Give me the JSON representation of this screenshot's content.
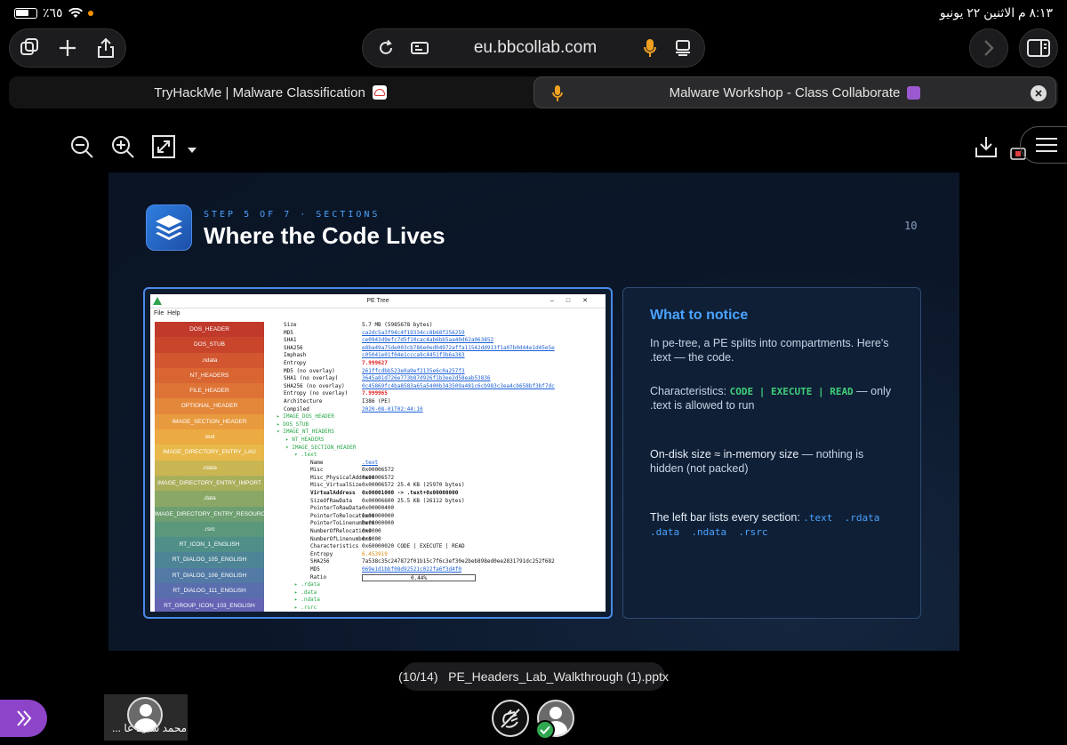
{
  "status_bar": {
    "battery": "٪٦٥",
    "time_date": "٨:١٣ م   الاثنين ٢٢ يونيو"
  },
  "browser": {
    "url": "eu.bbcollab.com",
    "tabs": [
      {
        "label": "TryHackMe | Malware Classification",
        "active": false
      },
      {
        "label": "Malware Workshop - Class Collaborate",
        "active": true
      }
    ]
  },
  "slide": {
    "step": "STEP 5 OF 7 · SECTIONS",
    "title": "Where the Code Lives",
    "page_number": "10",
    "pe_window": {
      "title": "PE Tree",
      "menu": [
        "File",
        "Help"
      ],
      "sections": [
        {
          "label": "DOS_HEADER",
          "color": "#c0392b"
        },
        {
          "label": "DOS_STUB",
          "color": "#c8452b"
        },
        {
          "label": ".ndata",
          "color": "#d2562f"
        },
        {
          "label": "NT_HEADERS",
          "color": "#d86532"
        },
        {
          "label": "FILE_HEADER",
          "color": "#de7336"
        },
        {
          "label": "OPTIONAL_HEADER",
          "color": "#e3873a"
        },
        {
          "label": "IMAGE_SECTION_HEADER",
          "color": "#e89a3e"
        },
        {
          "label": ".text",
          "color": "#ecaa42"
        },
        {
          "label": "IMAGE_DIRECTORY_ENTRY_LAU",
          "color": "#e8b94a"
        },
        {
          "label": ".rdata",
          "color": "#c9b552"
        },
        {
          "label": "IMAGE_DIRECTORY_ENTRY_IMPORT",
          "color": "#a9ae5b"
        },
        {
          "label": ".data",
          "color": "#8aa765"
        },
        {
          "label": "IMAGE_DIRECTORY_ENTRY_RESOURC",
          "color": "#6e9f70"
        },
        {
          "label": ".rsrc",
          "color": "#5a977b"
        },
        {
          "label": "RT_ICON_1_ENGLISH",
          "color": "#4f8f88"
        },
        {
          "label": "RT_DIALOG_105_ENGLISH",
          "color": "#4e8596"
        },
        {
          "label": "RT_DIALOG_106_ENGLISH",
          "color": "#527aa4"
        },
        {
          "label": "RT_DIALOG_111_ENGLISH",
          "color": "#5a6eae"
        },
        {
          "label": "RT_GROUP_ICON_103_ENGLISH",
          "color": "#6463b4"
        }
      ],
      "tree_rows": [
        {
          "k": "Size",
          "v": "5.7 MB (5985678 bytes)",
          "indent": 0,
          "style": "plain"
        },
        {
          "k": "MD5",
          "v": "ca2dc5a3f94c4f19334cc8b68f256259",
          "indent": 0,
          "style": "link"
        },
        {
          "k": "SHA1",
          "v": "ce0943d9efc7d5f10cac4ab6bb5aa40d62a063852",
          "indent": 0,
          "style": "link"
        },
        {
          "k": "SHA256",
          "v": "e8ba49a75de003cb786e0ed04972affa11542dd913f1a07b0d44e1d45e5e",
          "indent": 0,
          "style": "link"
        },
        {
          "k": "Imphash",
          "v": "c05041e01f04e1ccca9c4451f3b6a383",
          "indent": 0,
          "style": "link"
        },
        {
          "k": "Entropy",
          "v": "7.999627",
          "indent": 0,
          "style": "red"
        },
        {
          "k": "MD5 (no overlay)",
          "v": "261ffcdbb523e0a9ef2135e6c0a257f3",
          "indent": 0,
          "style": "link"
        },
        {
          "k": "SHA1 (no overlay)",
          "v": "3645a81d726e773b87d926f1b3ee2d58eab53836",
          "indent": 0,
          "style": "link"
        },
        {
          "k": "SHA256 (no overlay)",
          "v": "0c45869fc4ba8583a65a5400b343509a481c6cb983c3ea4cb658bf3bf7dc",
          "indent": 0,
          "style": "link"
        },
        {
          "k": "Entropy (no overlay)",
          "v": "7.999965",
          "indent": 0,
          "style": "red"
        },
        {
          "k": "Architecture",
          "v": "I386 (PE)",
          "indent": 0,
          "style": "plain"
        },
        {
          "k": "Compiled",
          "v": "2020-08-01T02:44:10",
          "indent": 0,
          "style": "link"
        },
        {
          "k": "▸ IMAGE_DOS_HEADER",
          "v": "",
          "indent": -8,
          "style": "green"
        },
        {
          "k": "▸ DOS_STUB",
          "v": "",
          "indent": -8,
          "style": "green"
        },
        {
          "k": "▾ IMAGE_NT_HEADERS",
          "v": "",
          "indent": -8,
          "style": "green"
        },
        {
          "k": "▸ NT_HEADERS",
          "v": "",
          "indent": 2,
          "style": "green"
        },
        {
          "k": "▾ IMAGE_SECTION_HEADER",
          "v": "",
          "indent": 2,
          "style": "green"
        },
        {
          "k": "▾ .text",
          "v": "",
          "indent": 12,
          "style": "green"
        },
        {
          "k": "Name",
          "v": ".text",
          "indent": 30,
          "style": "link"
        },
        {
          "k": "Misc",
          "v": "0x00006572",
          "indent": 30,
          "style": "plain"
        },
        {
          "k": "Misc_PhysicalAddress",
          "v": "0x00006572",
          "indent": 30,
          "style": "plain"
        },
        {
          "k": "Misc_VirtualSize",
          "v": "0x00006572 25.4 KB (25970 bytes)",
          "indent": 30,
          "style": "plain"
        },
        {
          "k": "VirtualAddress",
          "v": "0x00001000 -> .text+0x00000000",
          "indent": 30,
          "style": "bold"
        },
        {
          "k": "SizeOfRawData",
          "v": "0x00006600 25.5 KB (26112 bytes)",
          "indent": 30,
          "style": "plain"
        },
        {
          "k": "PointerToRawData",
          "v": "0x00000400",
          "indent": 30,
          "style": "plain"
        },
        {
          "k": "PointerToRelocations",
          "v": "0x00000000",
          "indent": 30,
          "style": "plain"
        },
        {
          "k": "PointerToLinenumbers",
          "v": "0x00000000",
          "indent": 30,
          "style": "plain"
        },
        {
          "k": "NumberOfRelocations",
          "v": "0x0000",
          "indent": 30,
          "style": "plain"
        },
        {
          "k": "NumberOfLinenumbers",
          "v": "0x0000",
          "indent": 30,
          "style": "plain"
        },
        {
          "k": "Characteristics",
          "v": "0x60000020 CODE | EXECUTE | READ",
          "indent": 30,
          "style": "plain"
        },
        {
          "k": "Entropy",
          "v": "6.453919",
          "indent": 30,
          "style": "orange"
        },
        {
          "k": "SHA256",
          "v": "7a538c35c247872f01b15c7f6c3ef30e2beb898ed0ee2831791dc252f682",
          "indent": 30,
          "style": "plain"
        },
        {
          "k": "MD5",
          "v": "069e1d1bbf08d92521c022fa6f3d4f0",
          "indent": 30,
          "style": "link"
        },
        {
          "k": "Ratio",
          "v": "0.44%",
          "indent": 30,
          "style": "bar"
        },
        {
          "k": "▸ .rdata",
          "v": "",
          "indent": 12,
          "style": "green"
        },
        {
          "k": "▸ .data",
          "v": "",
          "indent": 12,
          "style": "green"
        },
        {
          "k": "▸ .ndata",
          "v": "",
          "indent": 12,
          "style": "green"
        },
        {
          "k": "▸ .rsrc",
          "v": "",
          "indent": 12,
          "style": "green"
        }
      ]
    },
    "notice": {
      "title": "What to notice",
      "p1": "In pe-tree, a PE splits into compartments. Here's .text — the code.",
      "p2_prefix": "Characteristics: ",
      "p2_code": "CODE | EXECUTE | READ",
      "p2_suffix": " — only .text is allowed to run",
      "p3_a": "On-disk size ≈ in-memory size",
      "p3_b": "— nothing is hidden (not packed)",
      "p4_prefix": "The left bar lists every section: ",
      "p4_sections": ".text  .rdata  .data  .ndata  .rsrc"
    }
  },
  "bottom": {
    "file_label": "(10/14)   PE_Headers_Lab_Walkthrough (1).pptx",
    "participant_name": "محمد سعيد عا ..."
  },
  "colors": {
    "accent": "#4aa3ff",
    "slide_bg": "#0d1a2e",
    "session_purple": "#8e44c9"
  }
}
